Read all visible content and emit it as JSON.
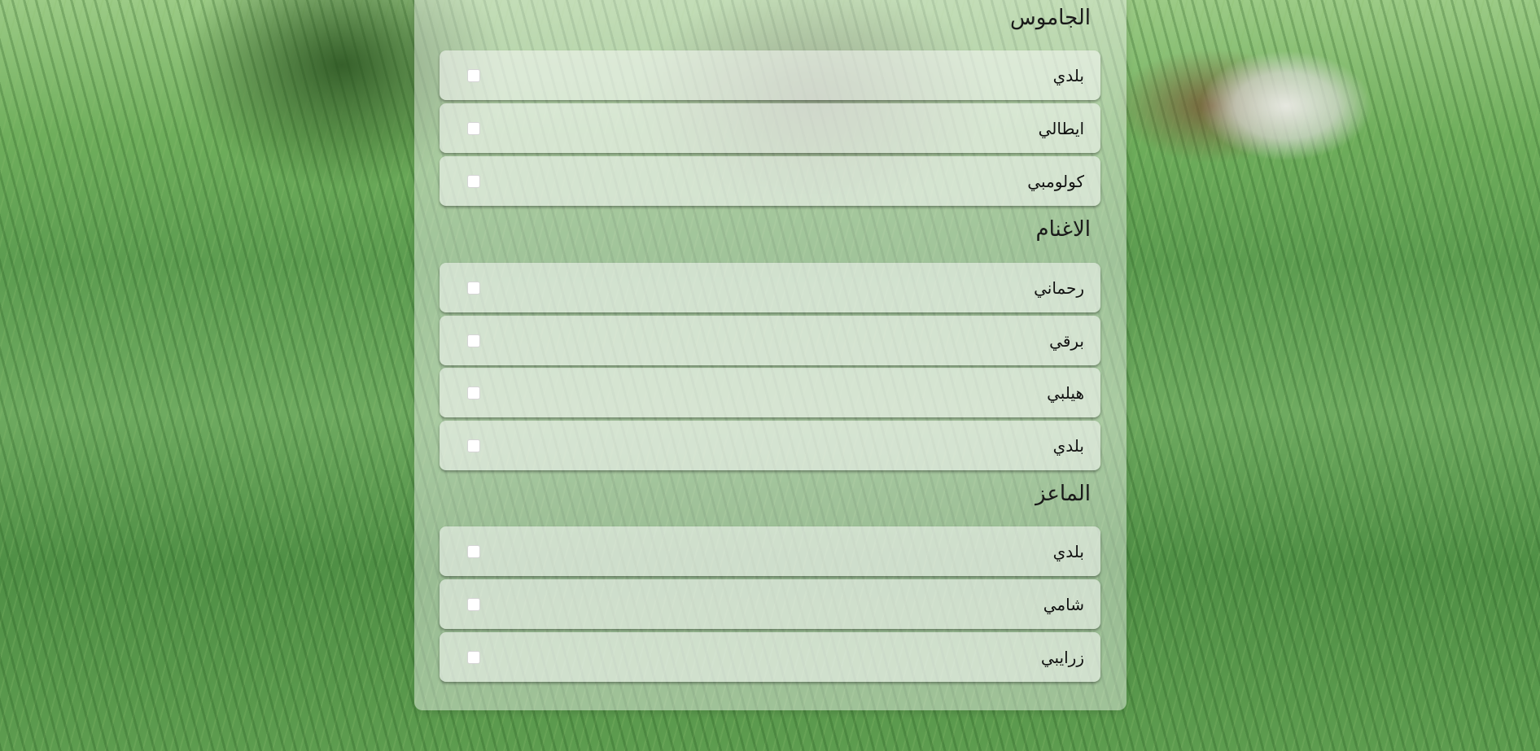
{
  "sections": [
    {
      "title": "الجاموس",
      "items": [
        {
          "label": "بلدي",
          "checked": false
        },
        {
          "label": "ايطالي",
          "checked": false
        },
        {
          "label": "كولومبي",
          "checked": false
        }
      ]
    },
    {
      "title": "الاغنام",
      "items": [
        {
          "label": "رحماني",
          "checked": false
        },
        {
          "label": "برقي",
          "checked": false
        },
        {
          "label": "هيلبي",
          "checked": false
        },
        {
          "label": "بلدي",
          "checked": false
        }
      ]
    },
    {
      "title": "الماعز",
      "items": [
        {
          "label": "بلدي",
          "checked": false
        },
        {
          "label": "شامي",
          "checked": false
        },
        {
          "label": "زرايبي",
          "checked": false
        }
      ]
    }
  ]
}
